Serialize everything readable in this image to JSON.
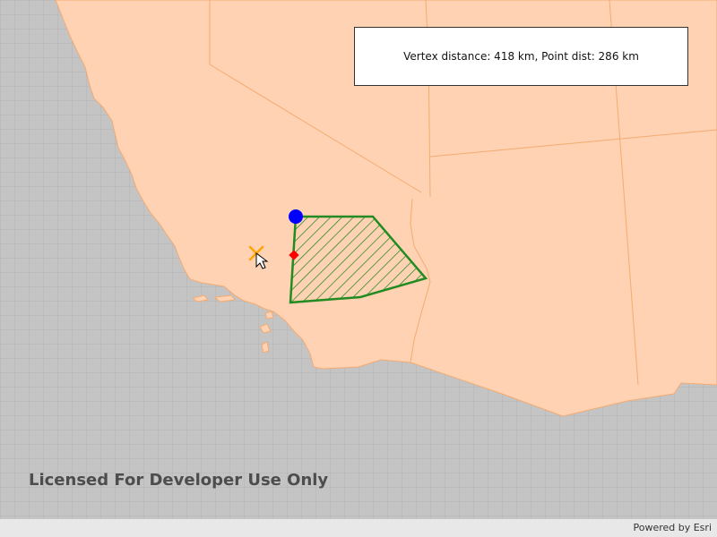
{
  "map": {
    "colors": {
      "ocean": "#c4c4c4",
      "ocean_grid": "#b3b3b3",
      "land": "#fed2b2",
      "state_border": "#f4ab72",
      "polygon_outline": "#228b22",
      "polygon_hatch": "#228b22",
      "vertex_marker": "#0000ff",
      "nearest_point_marker": "#ff0000",
      "tap_marker": "#ffa500"
    },
    "icons": {
      "tap_location": "x-marker-icon",
      "cursor": "mouse-pointer-icon",
      "nearest_vertex": "blue-circle-icon",
      "nearest_coordinate": "red-diamond-icon"
    }
  },
  "info": {
    "text": "Vertex distance: 418 km, Point dist: 286 km"
  },
  "watermark": {
    "text": "Licensed For Developer Use Only"
  },
  "attribution": {
    "text": "Powered by Esri"
  }
}
